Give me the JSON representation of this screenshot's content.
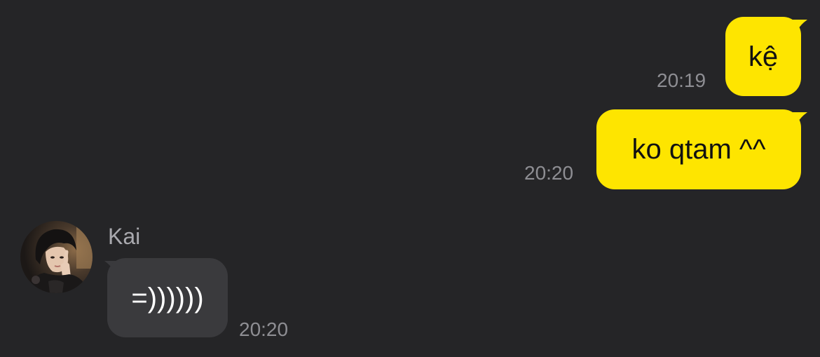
{
  "messages": [
    {
      "from": "me",
      "text": "kệ",
      "time": "20:19"
    },
    {
      "from": "me",
      "text": "ko qtam ^^",
      "time": "20:20"
    },
    {
      "from": "Kai",
      "sender_name": "Kai",
      "text": "=))))))",
      "time": "20:20"
    }
  ],
  "colors": {
    "background": "#252527",
    "sent_bubble": "#FEE500",
    "received_bubble": "#3A3A3D",
    "timestamp": "#8E8E93"
  },
  "icons": {
    "sender_avatar": "profile-photo"
  }
}
